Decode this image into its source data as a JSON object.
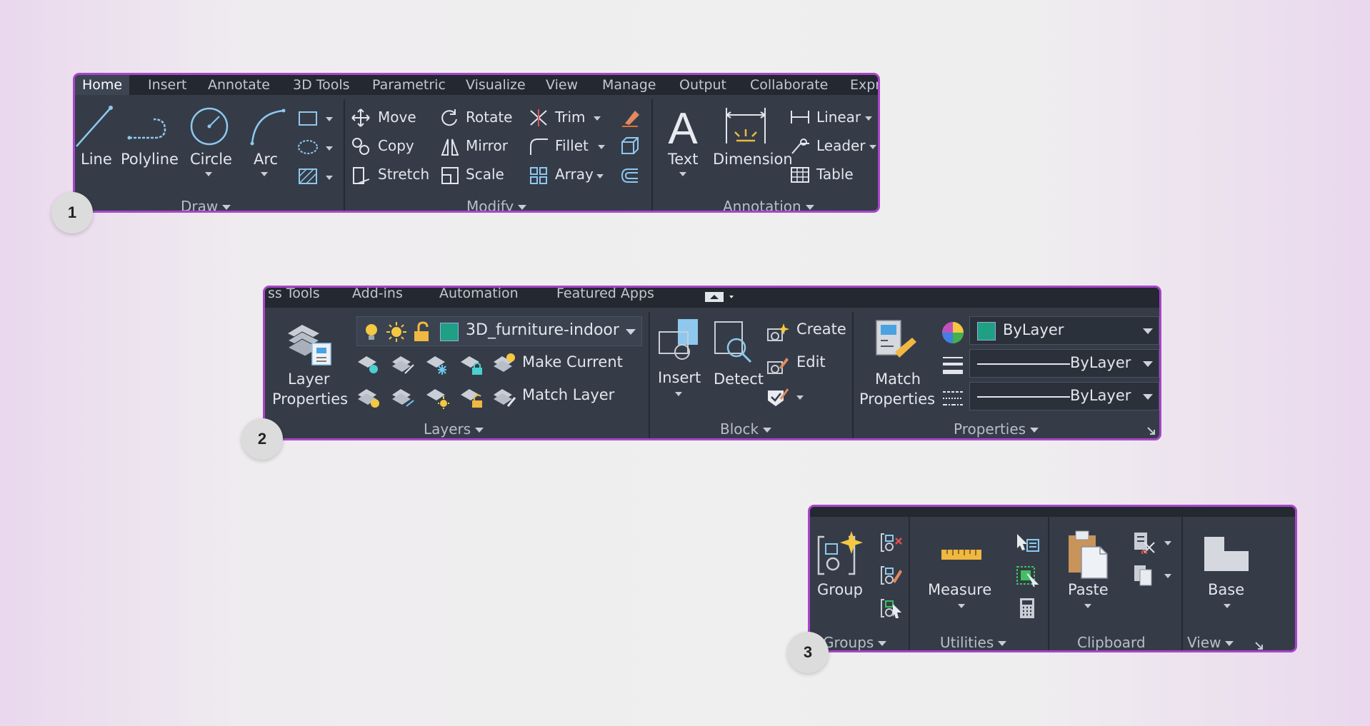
{
  "panel1": {
    "tabs": [
      "Home",
      "Insert",
      "Annotate",
      "3D Tools",
      "Parametric",
      "Visualize",
      "View",
      "Manage",
      "Output",
      "Collaborate",
      "Expr"
    ],
    "active_tab": "Home",
    "draw": {
      "line": "Line",
      "polyline": "Polyline",
      "circle": "Circle",
      "arc": "Arc",
      "group_label": "Draw"
    },
    "modify": {
      "move": "Move",
      "rotate": "Rotate",
      "trim": "Trim",
      "copy": "Copy",
      "mirror": "Mirror",
      "fillet": "Fillet",
      "stretch": "Stretch",
      "scale": "Scale",
      "array": "Array",
      "group_label": "Modify"
    },
    "annotation": {
      "text": "Text",
      "dimension": "Dimension",
      "linear": "Linear",
      "leader": "Leader",
      "table": "Table",
      "group_label": "Annotation"
    },
    "badge": "1"
  },
  "panel2": {
    "tabs": [
      "ss Tools",
      "Add-ins",
      "Automation",
      "Featured Apps"
    ],
    "layers": {
      "layer_properties_1": "Layer",
      "layer_properties_2": "Properties",
      "current_layer": "3D_furniture-indoor",
      "make_current": "Make Current",
      "match_layer": "Match Layer",
      "group_label": "Layers"
    },
    "block": {
      "insert": "Insert",
      "detect": "Detect",
      "create": "Create",
      "edit": "Edit",
      "group_label": "Block"
    },
    "properties": {
      "match_1": "Match",
      "match_2": "Properties",
      "color": "ByLayer",
      "lineweight": "ByLayer",
      "linetype": "ByLayer",
      "group_label": "Properties"
    },
    "badge": "2"
  },
  "panel3": {
    "groups": {
      "group": "Group",
      "group_label": "Groups"
    },
    "utilities": {
      "measure": "Measure",
      "group_label": "Utilities"
    },
    "clipboard": {
      "paste": "Paste",
      "group_label": "Clipboard"
    },
    "view": {
      "base": "Base",
      "group_label": "View"
    },
    "badge": "3"
  },
  "colors": {
    "panel_bg": "#353c48",
    "border": "#a845c9",
    "layer_swatch": "#1f9f83"
  }
}
